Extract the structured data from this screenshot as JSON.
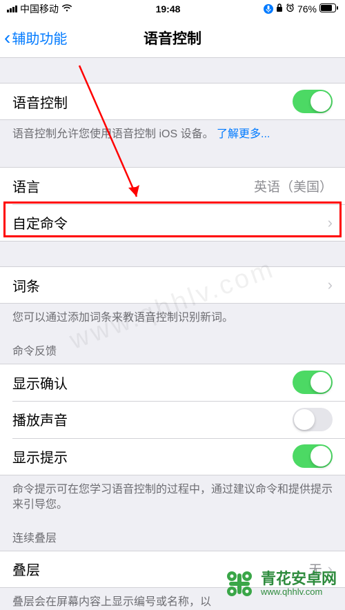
{
  "status": {
    "carrier": "中国移动",
    "time": "19:48",
    "battery": "76%"
  },
  "nav": {
    "back": "辅助功能",
    "title": "语音控制"
  },
  "voice_control": {
    "label": "语音控制",
    "on": true,
    "footer_text": "语音控制允许您使用语音控制 iOS 设备。",
    "learn_more": "了解更多..."
  },
  "language": {
    "label": "语言",
    "value": "英语（美国）"
  },
  "custom_commands": {
    "label": "自定命令"
  },
  "vocabulary": {
    "label": "词条",
    "footer": "您可以通过添加词条来教语音控制识别新词。"
  },
  "feedback_header": "命令反馈",
  "show_confirm": {
    "label": "显示确认",
    "on": true
  },
  "play_sound": {
    "label": "播放声音",
    "on": false
  },
  "show_hints": {
    "label": "显示提示",
    "on": true
  },
  "hints_footer": "命令提示可在您学习语音控制的过程中，通过建议命令和提供提示来引导您。",
  "overlay_header": "连续叠层",
  "overlay": {
    "label": "叠层",
    "value": "无"
  },
  "overlay_footer": "叠层会在屏幕内容上显示编号或名称，以",
  "watermark": "www.qhhlv.com",
  "brand": {
    "name": "青花安卓网",
    "url": "www.qhhlv.com"
  }
}
